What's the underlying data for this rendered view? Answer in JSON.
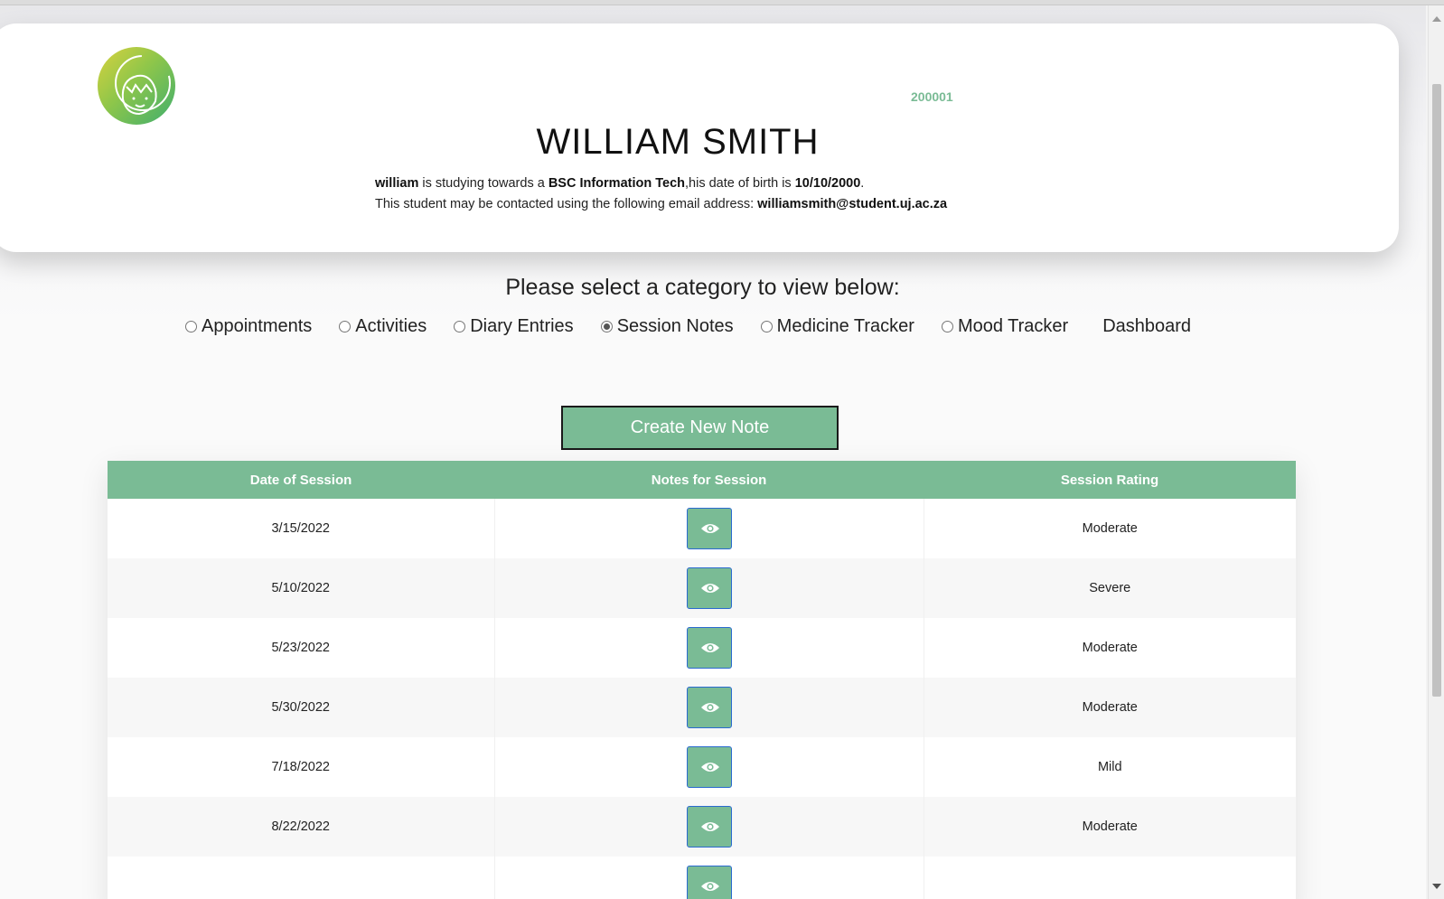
{
  "student": {
    "id": "200001",
    "name": "WILLIAM SMITH",
    "first_name": "william",
    "bio_text_1": " is studying towards a ",
    "degree": "BSC Information Tech",
    "bio_text_2": ",his date of birth is ",
    "dob": "10/10/2000",
    "bio_text_3": ".",
    "contact_text": "This student may be contacted using the following email address: ",
    "email": "williamsmith@student.uj.ac.za"
  },
  "category_prompt": "Please select a category to view below:",
  "categories": [
    {
      "label": "Appointments",
      "selected": false
    },
    {
      "label": "Activities",
      "selected": false
    },
    {
      "label": "Diary Entries",
      "selected": false
    },
    {
      "label": "Session Notes",
      "selected": true
    },
    {
      "label": "Medicine Tracker",
      "selected": false
    },
    {
      "label": "Mood Tracker",
      "selected": false
    }
  ],
  "dashboard_label": "Dashboard",
  "create_button": "Create New Note",
  "table": {
    "headers": [
      "Date of Session",
      "Notes for Session",
      "Session Rating"
    ],
    "view_icon": "eye-icon",
    "rows": [
      {
        "date": "3/15/2022",
        "rating": "Moderate"
      },
      {
        "date": "5/10/2022",
        "rating": "Severe"
      },
      {
        "date": "5/23/2022",
        "rating": "Moderate"
      },
      {
        "date": "5/30/2022",
        "rating": "Moderate"
      },
      {
        "date": "7/18/2022",
        "rating": "Mild"
      },
      {
        "date": "8/22/2022",
        "rating": "Moderate"
      },
      {
        "date": "",
        "rating": ""
      }
    ]
  },
  "colors": {
    "accent": "#7abb95",
    "view_button_border": "#2a6ad0"
  }
}
